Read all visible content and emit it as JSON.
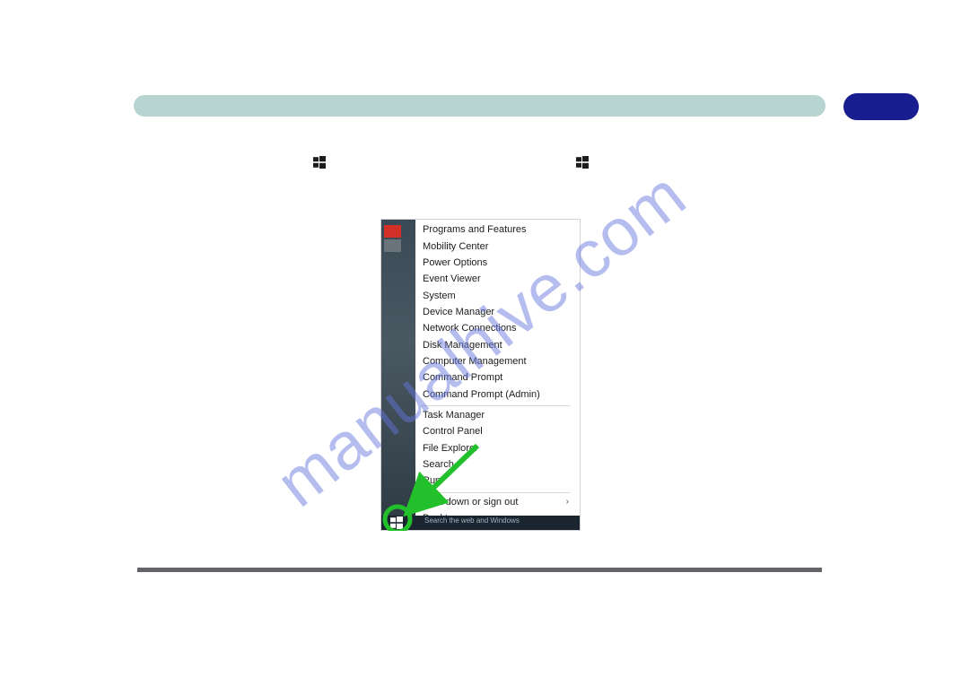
{
  "watermark": "manualhive.com",
  "taskbar": {
    "search_hint": "Search the web and Windows"
  },
  "menu": {
    "group1": [
      "Programs and Features",
      "Mobility Center",
      "Power Options",
      "Event Viewer",
      "System",
      "Device Manager",
      "Network Connections",
      "Disk Management",
      "Computer Management",
      "Command Prompt",
      "Command Prompt (Admin)"
    ],
    "group2": [
      "Task Manager",
      "Control Panel",
      "File Explorer",
      "Search",
      "Run"
    ],
    "group3_submenu": "Shut down or sign out",
    "group3_last": "Desktop"
  }
}
